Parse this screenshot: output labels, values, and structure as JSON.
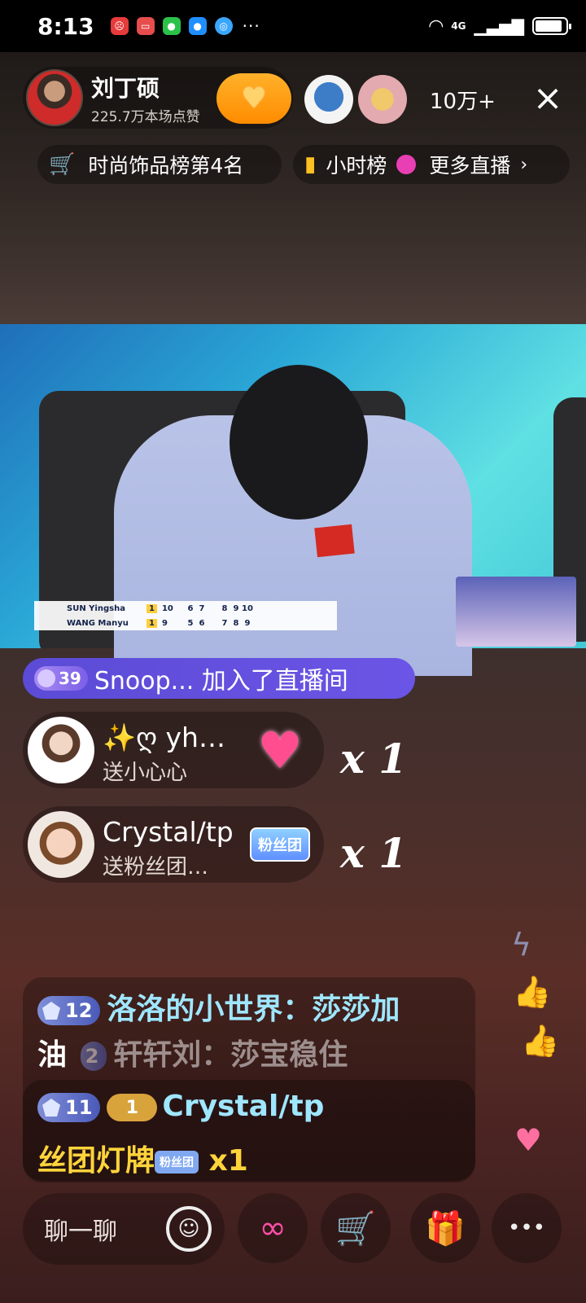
{
  "status_bar": {
    "time": "8:13",
    "network": "4G",
    "more": "···",
    "battery_level": 0.9
  },
  "header": {
    "host_name": "刘丁硕",
    "host_likes": "225.7万本场点赞",
    "viewer_count": "10万+",
    "close_icon": "×"
  },
  "rank": {
    "fashion_rank": "时尚饰品榜第4名",
    "hourly_rank": "小时榜",
    "more_live": "更多直播"
  },
  "scoreboard": {
    "player1": "SUN Yingsha",
    "player2": "WANG Manyu",
    "p1_games": "1",
    "p1_points": "10",
    "p2_games": "1",
    "p2_points": "9",
    "p1_history": [
      "6",
      "7",
      "",
      "8",
      "9",
      "10"
    ],
    "p2_history": [
      "5",
      "6",
      "",
      "7",
      "8",
      "9"
    ]
  },
  "join": {
    "level": "39",
    "text": "Snoop... 加入了直播间"
  },
  "gifts": [
    {
      "user": "✨ღ yh…",
      "desc": "送小心心",
      "count": "x 1",
      "gift_icon": "heart-gift-icon"
    },
    {
      "user": "Crystal/tp",
      "desc": "送粉丝团…",
      "count": "x 1",
      "gift_icon": "fan-club-gift-icon",
      "gift_label": "粉丝团"
    }
  ],
  "chat": [
    {
      "level": "12",
      "text_a": "洛洛的小世界：莎莎加",
      "text_b": "油"
    },
    {
      "level": "2",
      "text": "轩轩刘：莎宝稳住"
    },
    {
      "level": "11",
      "fan_level": "1",
      "user": "Crystal/tp",
      "text": "丝团灯牌",
      "tag": "粉丝团",
      "count": "x1"
    }
  ],
  "bottom": {
    "input_placeholder": "聊一聊",
    "emoji": "☺",
    "more": "•••"
  },
  "colors": {
    "follow": "#ff9a10",
    "join_banner": "#5b4bd6",
    "chat_name": "#9fe6ff",
    "fan_highlight": "#ffd43b"
  }
}
